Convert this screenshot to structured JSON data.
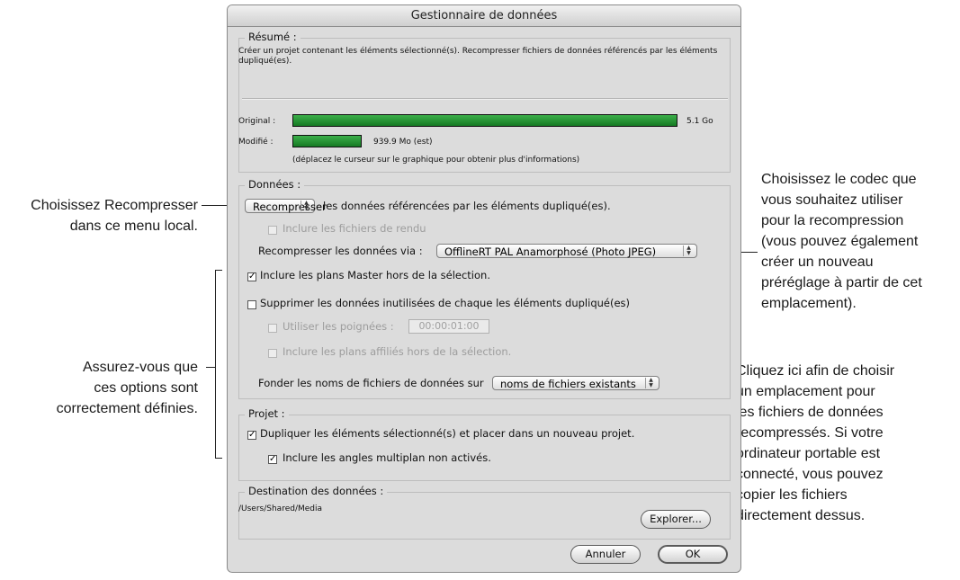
{
  "window": {
    "title": "Gestionnaire de données"
  },
  "summary": {
    "label": "Résumé :",
    "description_line1": "Créer un projet contenant les éléments sélectionné(s). Recompresser fichiers de données référencés par les éléments",
    "description_line2": "dupliqué(es).",
    "original_label": "Original :",
    "original_value": "5.1 Go",
    "modified_label": "Modifié :",
    "modified_value": "939.9 Mo (est)",
    "modified_fraction": 0.18,
    "hint": "(déplacez le curseur sur le graphique pour obtenir plus d'informations)"
  },
  "media": {
    "label": "Données :",
    "action_popup": "Recompresser",
    "action_suffix": "les données référencées par les éléments dupliqué(es).",
    "include_render_files": "Inclure les fichiers de rendu",
    "recompress_via_label": "Recompresser les données via :",
    "codec_popup": "OfflineRT PAL Anamorphosé (Photo JPEG)",
    "include_master_clips": "Inclure les plans Master hors de la sélection.",
    "delete_unused": "Supprimer les données inutilisées de chaque les éléments dupliqué(es)",
    "use_handles": "Utiliser les poignées :",
    "handles_value": "00:00:01:00",
    "include_affiliate_clips": "Inclure les plans affiliés hors de la sélection.",
    "base_names_label": "Fonder les noms de fichiers de données sur",
    "base_names_popup": "noms de fichiers existants"
  },
  "project": {
    "label": "Projet :",
    "duplicate_items": "Dupliquer les éléments sélectionné(s) et placer dans un nouveau projet.",
    "include_multiclip": "Inclure les angles multiplan non activés."
  },
  "destination": {
    "label": "Destination des données :",
    "path": "/Users/Shared/Media",
    "browse_button": "Explorer..."
  },
  "buttons": {
    "cancel": "Annuler",
    "ok": "OK"
  },
  "callouts": {
    "recompress": [
      "Choisissez Recompresser",
      "dans ce menu local."
    ],
    "options": [
      "Assurez-vous que",
      "ces options sont",
      "correctement définies."
    ],
    "codec": [
      "Choisissez le codec que",
      "vous souhaitez utiliser",
      "pour la recompression",
      "(vous pouvez également",
      "créer un nouveau",
      "préréglage à partir de cet",
      "emplacement)."
    ],
    "destination": [
      "Cliquez ici afin de choisir",
      "un emplacement pour",
      "les fichiers de données",
      "recompressés. Si votre",
      "ordinateur portable est",
      "connecté, vous pouvez",
      "copier les fichiers",
      "directement dessus."
    ]
  }
}
